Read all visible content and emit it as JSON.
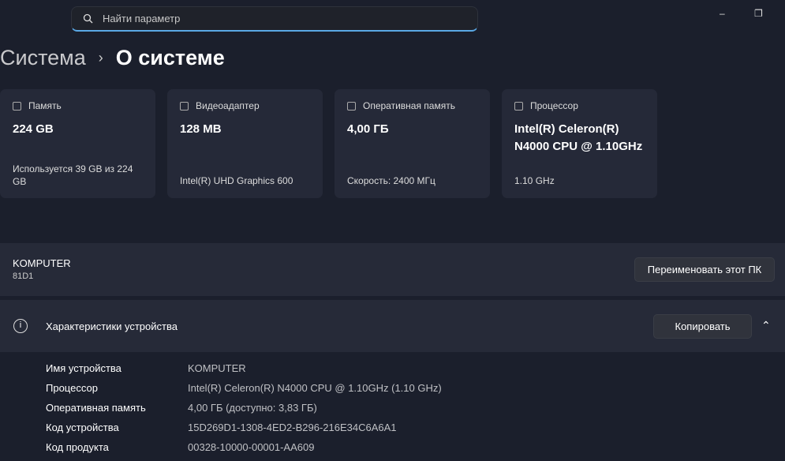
{
  "search": {
    "placeholder": "Найти параметр"
  },
  "window": {
    "minimize": "–",
    "restore": "❐"
  },
  "breadcrumb": {
    "parent": "Система",
    "separator": "›",
    "current": "О системе"
  },
  "cards": [
    {
      "icon": "storage-icon",
      "title": "Память",
      "value": "224 GB",
      "sub": "Используется 39 GB из 224 GB"
    },
    {
      "icon": "gpu-icon",
      "title": "Видеоадаптер",
      "value": "128 MB",
      "sub": "Intel(R) UHD Graphics 600"
    },
    {
      "icon": "ram-icon",
      "title": "Оперативная память",
      "value": "4,00 ГБ",
      "sub": "Скорость: 2400 МГц"
    },
    {
      "icon": "cpu-icon",
      "title": "Процессор",
      "value": "Intel(R) Celeron(R) N4000 CPU @ 1.10GHz",
      "sub": "1.10 GHz"
    }
  ],
  "pc": {
    "name": "KOMPUTER",
    "model": "81D1",
    "rename": "Переименовать этот ПК"
  },
  "device": {
    "title": "Характеристики устройства",
    "copy": "Копировать",
    "info": "i",
    "chevron": "⌃",
    "specs": [
      {
        "k": "Имя устройства",
        "v": "KOMPUTER"
      },
      {
        "k": "Процессор",
        "v": "Intel(R) Celeron(R) N4000 CPU @ 1.10GHz (1.10 GHz)"
      },
      {
        "k": "Оперативная память",
        "v": "4,00 ГБ (доступно: 3,83 ГБ)"
      },
      {
        "k": "Код устройства",
        "v": "15D269D1-1308-4ED2-B296-216E34C6A6A1"
      },
      {
        "k": "Код продукта",
        "v": "00328-10000-00001-AA609"
      }
    ]
  }
}
